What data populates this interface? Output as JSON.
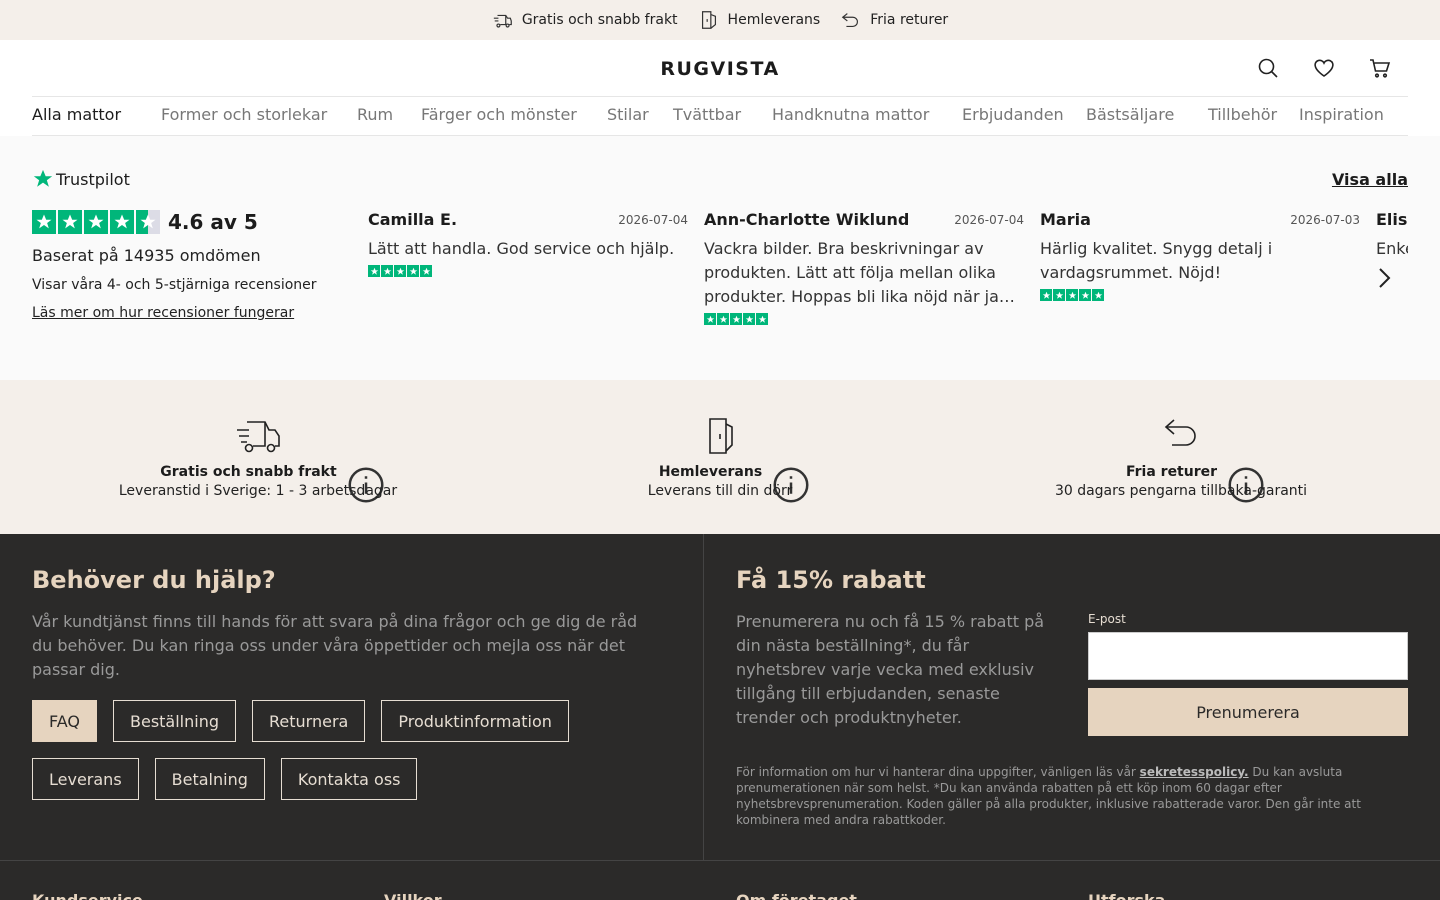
{
  "topbar": {
    "usps": [
      "Gratis och snabb frakt",
      "Hemleverans",
      "Fria returer"
    ]
  },
  "header": {
    "logo": "RUGVISTA",
    "icons": [
      "search-icon",
      "heart-icon",
      "cart-icon"
    ]
  },
  "nav": {
    "items": [
      "Alla mattor",
      "Former och storlekar",
      "Rum",
      "Färger och mönster",
      "Stilar",
      "Tvättbar",
      "Handknutna mattor",
      "Erbjudanden",
      "Bästsäljare",
      "Tillbehör",
      "Inspiration"
    ]
  },
  "reviews": {
    "brand": "Trustpilot",
    "view_all": "Visa alla",
    "score": "4.6 av 5",
    "based_on": "Baserat på 14935 omdömen",
    "showing": "Visar våra 4- och 5-stjärniga recensioner",
    "read_more": "Läs mer om hur recensioner fungerar",
    "rating_value": 4.6,
    "items": [
      {
        "name": "Camilla E.",
        "date": "2026-07-04",
        "text": "Lätt att handla. God service och hjälp.",
        "stars": 5
      },
      {
        "name": "Ann-Charlotte Wiklund",
        "date": "2026-07-04",
        "text": "Vackra bilder. Bra beskrivningar av produkten. Lätt att följa mellan olika produkter. Hoppas bli lika nöjd när ja…",
        "stars": 5
      },
      {
        "name": "Maria",
        "date": "2026-07-03",
        "text": "Härlig kvalitet. Snygg detalj i vardagsrummet. Nöjd!",
        "stars": 5
      },
      {
        "name": "Elis",
        "date": "",
        "text": "Enke",
        "stars": 5
      }
    ]
  },
  "usps": [
    {
      "title": "Gratis och snabb frakt",
      "sub": "Leveranstid i Sverige: 1 - 3 arbetsdagar",
      "icon": "truck-icon"
    },
    {
      "title": "Hemleverans",
      "sub": "Leverans till din dörr",
      "icon": "door-icon"
    },
    {
      "title": "Fria returer",
      "sub": "30 dagars pengarna tillbaka-garanti",
      "icon": "return-arrow-icon"
    }
  ],
  "help": {
    "title": "Behöver du hjälp?",
    "text": "Vår kundtjänst finns till hands för att svara på dina frågor och ge dig de råd du behöver. Du kan ringa oss under våra öppettider och mejla oss när det passar dig.",
    "buttons": [
      "FAQ",
      "Beställning",
      "Returnera",
      "Produktinformation",
      "Leverans",
      "Betalning",
      "Kontakta oss"
    ]
  },
  "subscribe": {
    "title": "Få 15% rabatt",
    "text": "Prenumerera nu och få 15 % rabatt på din nästa beställning*, du får nyhetsbrev varje vecka med exklusiv tillgång till erbjudanden, senaste trender och produktnyheter.",
    "email_label": "E-post",
    "email_value": "",
    "button": "Prenumerera",
    "legal_before": "För information om hur vi hanterar dina uppgifter, vänligen läs vår ",
    "legal_link": "sekretesspolicy.",
    "legal_after": " Du kan avsluta prenumerationen när som helst. *Du kan använda rabatten på ett köp inom 60 dagar efter nyhetsbrevsprenumeration. Koden gäller på alla produkter, inklusive rabatterade varor. Den går inte att kombinera med andra rabattkoder."
  },
  "footer_cols": [
    "Kundservice",
    "Villkor",
    "Om företaget",
    "Utforska"
  ],
  "colors": {
    "beige_bg": "#f4efea",
    "trustpilot_green": "#00b67a",
    "footer_bg": "#2b2a29",
    "accent_beige": "#e6d4bf"
  }
}
